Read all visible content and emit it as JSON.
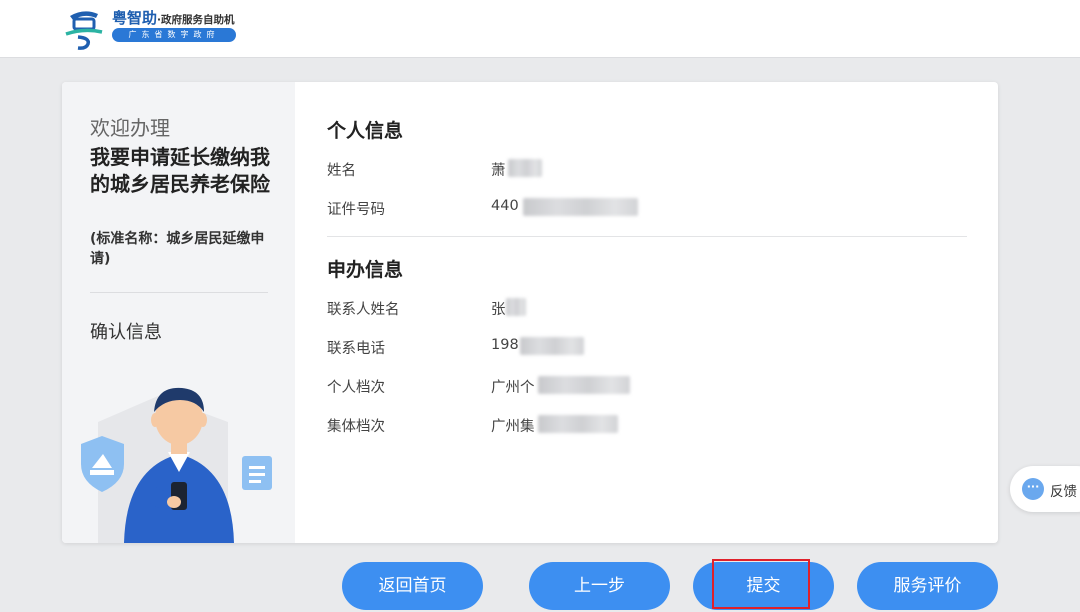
{
  "header": {
    "brand_name": "粤智助",
    "brand_sub": "·政府服务自助机",
    "brand_pill": "广东省数字政府"
  },
  "left_panel": {
    "welcome": "欢迎办理",
    "service_title": "我要申请延长缴纳我的城乡居民养老保险",
    "standard_name": "(标准名称：城乡居民延缴申请)",
    "current_step": "确认信息"
  },
  "personal_info": {
    "title": "个人信息",
    "fields": [
      {
        "label": "姓名",
        "value": "萧"
      },
      {
        "label": "证件号码",
        "value": "440"
      }
    ]
  },
  "application_info": {
    "title": "申办信息",
    "fields": [
      {
        "label": "联系人姓名",
        "value": "张"
      },
      {
        "label": "联系电话",
        "value": "198"
      },
      {
        "label": "个人档次",
        "value": "广州个"
      },
      {
        "label": "集体档次",
        "value": "广州集"
      }
    ]
  },
  "feedback": {
    "label": "反馈",
    "icon": "chat-dots-icon"
  },
  "buttons": {
    "home": "返回首页",
    "prev": "上一步",
    "submit": "提交",
    "rating": "服务评价"
  },
  "colors": {
    "primary": "#3d8ff1",
    "highlight": "#e0212b",
    "brand": "#1f5fb0"
  }
}
